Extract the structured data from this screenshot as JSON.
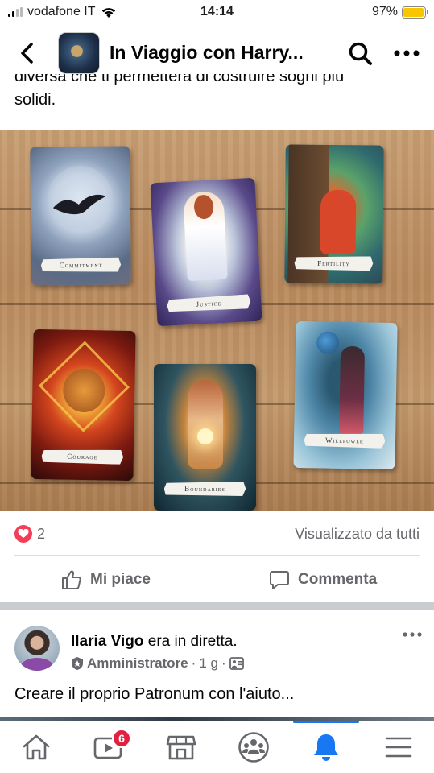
{
  "status_bar": {
    "carrier": "vodafone IT",
    "time": "14:14",
    "battery": "97%",
    "battery_level": 0.97
  },
  "header": {
    "title": "In Viaggio con Harry..."
  },
  "post": {
    "text_cut": "diversa che ti permetterà di costruire sogni più",
    "text_last": "solidi.",
    "cards": [
      "Commitment",
      "Justice",
      "Fertility",
      "Courage",
      "Boundaries",
      "Willpower"
    ],
    "reaction_count": "2",
    "seen_by": "Visualizzato da tutti",
    "like_label": "Mi piace",
    "comment_label": "Commenta"
  },
  "next_post": {
    "author": "Ilaria Vigo",
    "action": "era in diretta.",
    "role": "Amministratore",
    "time": "1 g",
    "separator": "·",
    "text": "Creare il proprio Patronum con l'aiuto..."
  },
  "tabbar": {
    "watch_badge": "6",
    "active_tab": "notifications",
    "accent_color": "#1877f2",
    "tabs": [
      "home-icon",
      "watch-icon",
      "marketplace-icon",
      "groups-icon",
      "notifications-bell-icon",
      "menu-icon"
    ]
  }
}
